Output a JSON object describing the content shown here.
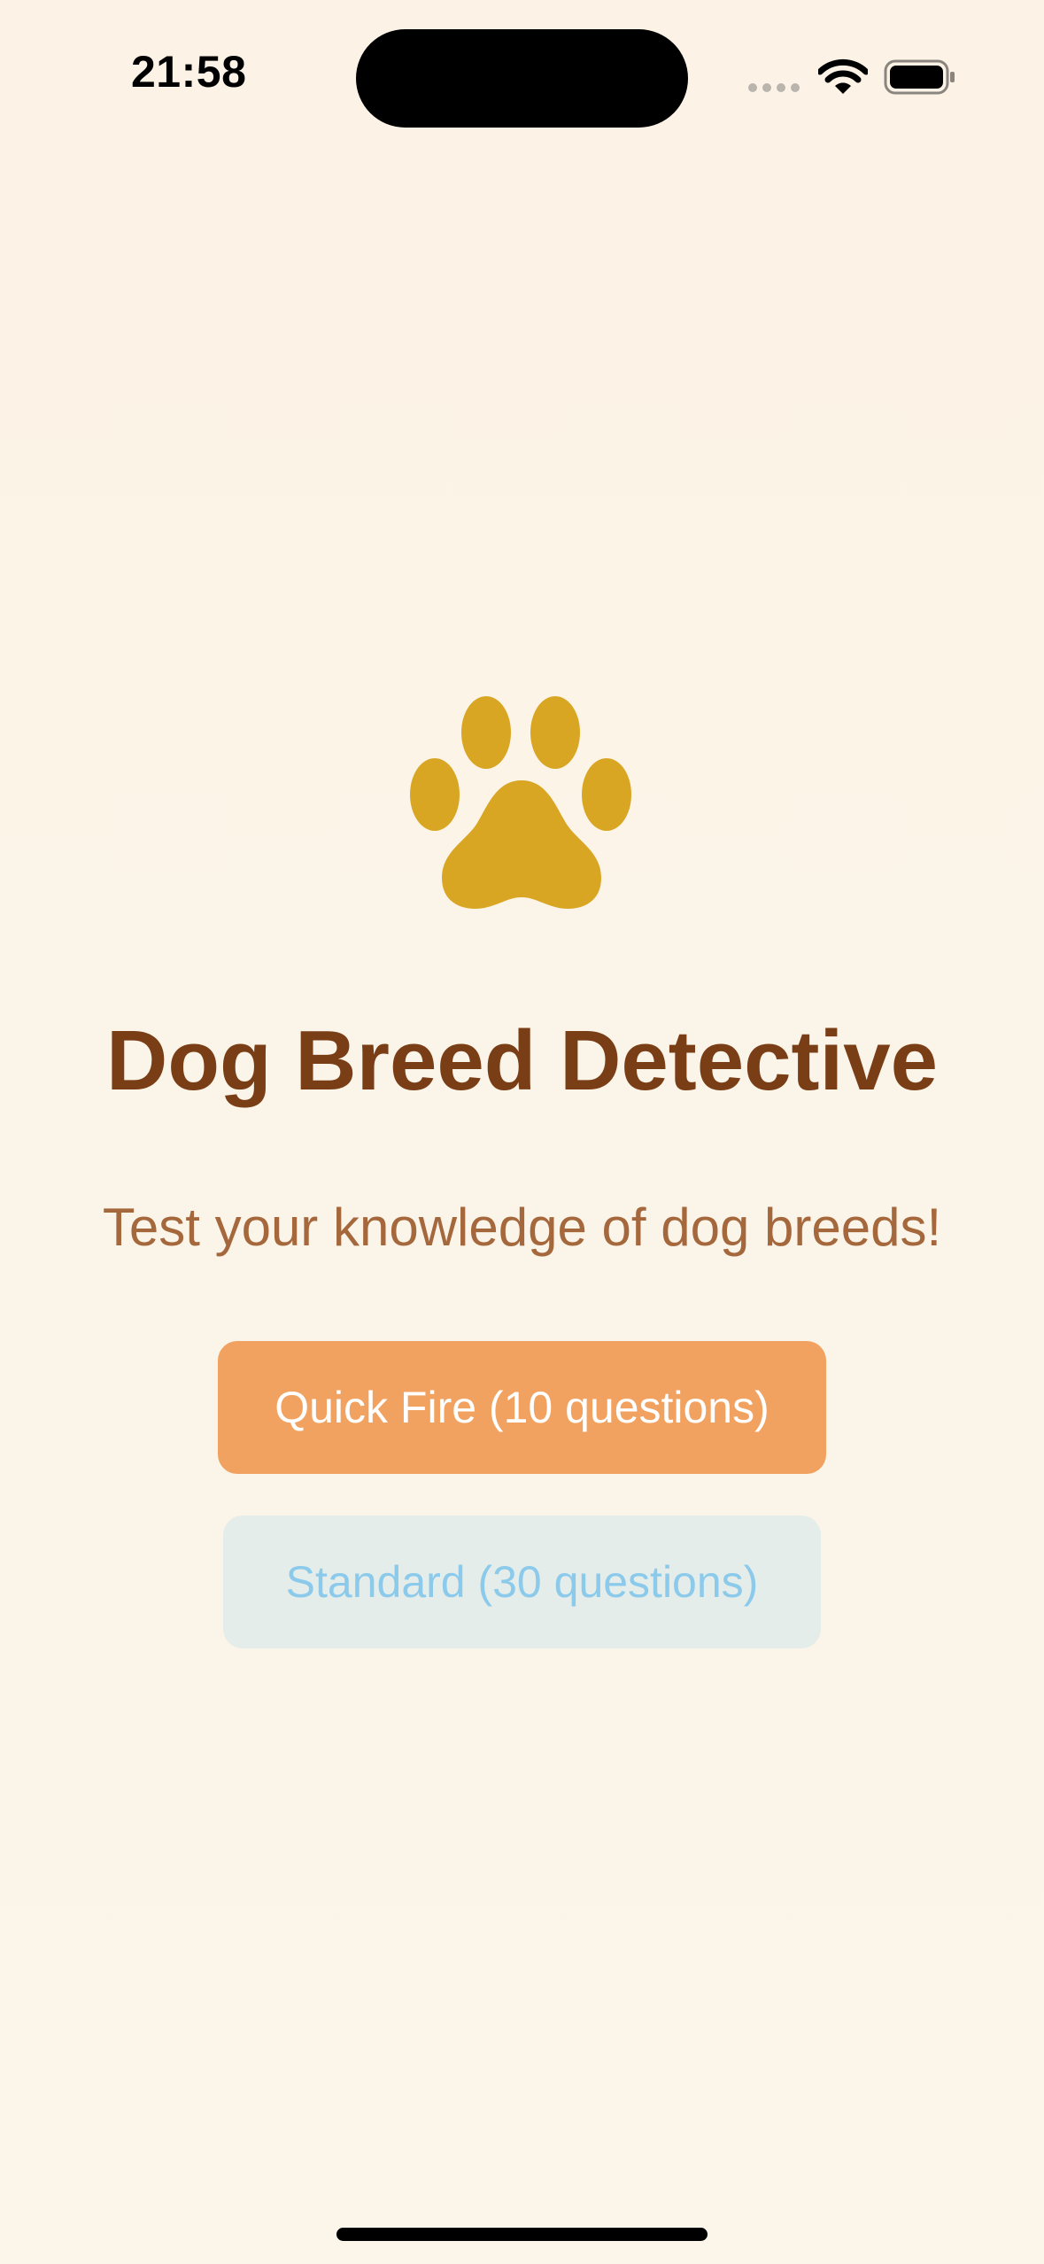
{
  "status_bar": {
    "time": "21:58"
  },
  "app": {
    "icon": "paw-icon",
    "title": "Dog Breed Detective",
    "subtitle": "Test your knowledge of dog breeds!"
  },
  "modes": {
    "quick_fire_label": "Quick Fire (10 questions)",
    "standard_label": "Standard (30 questions)"
  },
  "colors": {
    "background": "#fcf3e6",
    "paw": "#d9a623",
    "title": "#7a3e17",
    "subtitle": "#a5683d",
    "quick_fire_button": "#f2a260",
    "standard_button": "#e4ede9",
    "standard_button_text": "#8ccaec"
  }
}
